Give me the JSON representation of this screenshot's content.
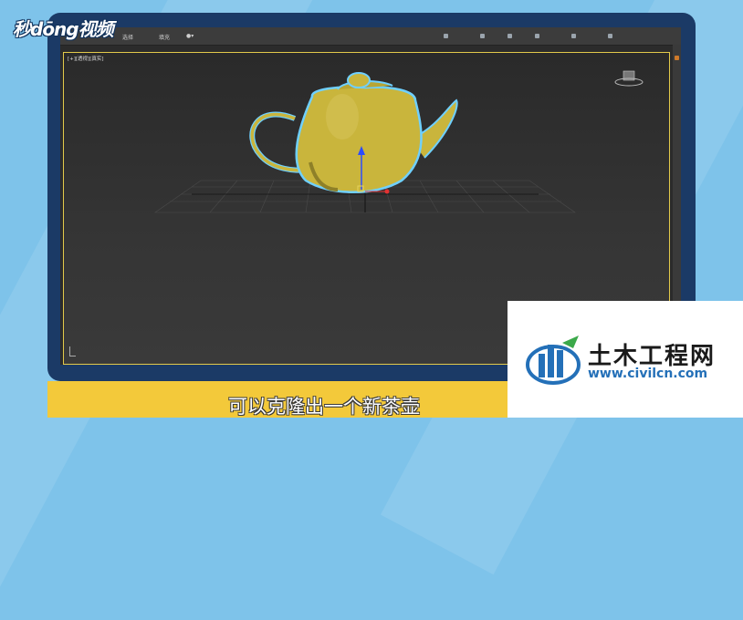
{
  "brand": {
    "logo_text": "秒dōng视频"
  },
  "app": {
    "toolbar_items": [
      "选择",
      "填充",
      "●▾"
    ],
    "viewport_label": "[+][透视][真实]"
  },
  "subtitle": {
    "text": "可以克隆出一个新茶壶"
  },
  "watermark": {
    "title": "土木工程网",
    "url": "www.civilcn.com"
  },
  "colors": {
    "teapot": "#c9b53c",
    "selection_outline": "#6fd0ff",
    "viewport_border": "#e2c94a",
    "subtitle_bar": "#f3c93a",
    "frame": "#1b3a66"
  }
}
